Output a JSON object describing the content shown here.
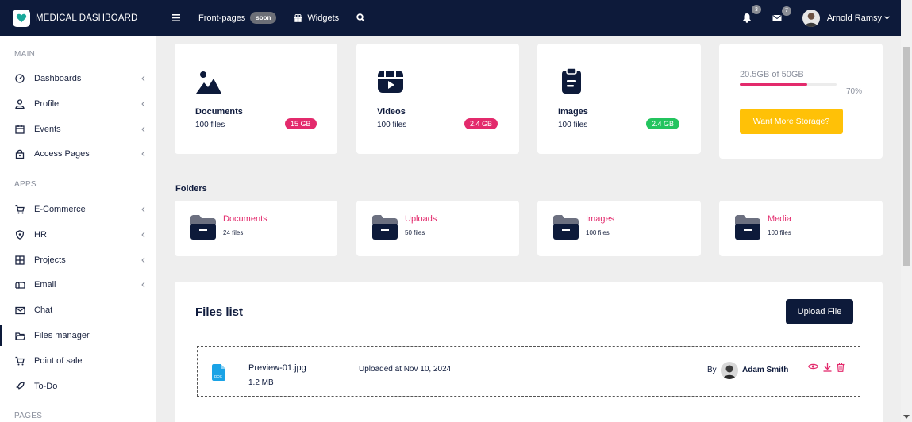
{
  "brand": {
    "name": "MEDICAL DASHBOARD"
  },
  "topnav": {
    "front_pages": "Front-pages",
    "soon": "soon",
    "widgets": "Widgets"
  },
  "topright": {
    "notifications_count": "3",
    "messages_count": "7",
    "user_name": "Arnold Ramsy"
  },
  "sidebar": {
    "sections": {
      "main": "MAIN",
      "apps": "APPS",
      "pages": "PAGES"
    },
    "main_items": [
      {
        "label": "Dashboards"
      },
      {
        "label": "Profile"
      },
      {
        "label": "Events"
      },
      {
        "label": "Access Pages"
      }
    ],
    "apps_items": [
      {
        "label": "E-Commerce"
      },
      {
        "label": "HR"
      },
      {
        "label": "Projects"
      },
      {
        "label": "Email"
      },
      {
        "label": "Chat"
      },
      {
        "label": "Files manager"
      },
      {
        "label": "Point of sale"
      },
      {
        "label": "To-Do"
      }
    ]
  },
  "storage": [
    {
      "name": "Documents",
      "files": "100 files",
      "size": "15 GB",
      "color": "#e32a6c"
    },
    {
      "name": "Videos",
      "files": "100 files",
      "size": "2.4 GB",
      "color": "#e32a6c"
    },
    {
      "name": "Images",
      "files": "100 files",
      "size": "2.4 GB",
      "color": "#23c45e"
    }
  ],
  "usage": {
    "text": "20.5GB of 50GB",
    "percent_label": "70%",
    "percent": 70,
    "button": "Want More Storage?"
  },
  "folders": {
    "title": "Folders",
    "items": [
      {
        "name": "Documents",
        "count": "24 files"
      },
      {
        "name": "Uploads",
        "count": "50 files"
      },
      {
        "name": "Images",
        "count": "100 files"
      },
      {
        "name": "Media",
        "count": "100 files"
      }
    ]
  },
  "files_list": {
    "title": "Files list",
    "upload_button": "Upload File",
    "rows": [
      {
        "name": "Preview-01.jpg",
        "size": "1.2 MB",
        "uploaded": "Uploaded at Nov 10, 2024",
        "by": "By",
        "user": "Adam Smith"
      }
    ]
  },
  "colors": {
    "navy": "#0d1a3a",
    "pink": "#e32a6c",
    "green": "#23c45e",
    "yellow": "#ffc107",
    "doc_blue": "#1aa3e6"
  }
}
